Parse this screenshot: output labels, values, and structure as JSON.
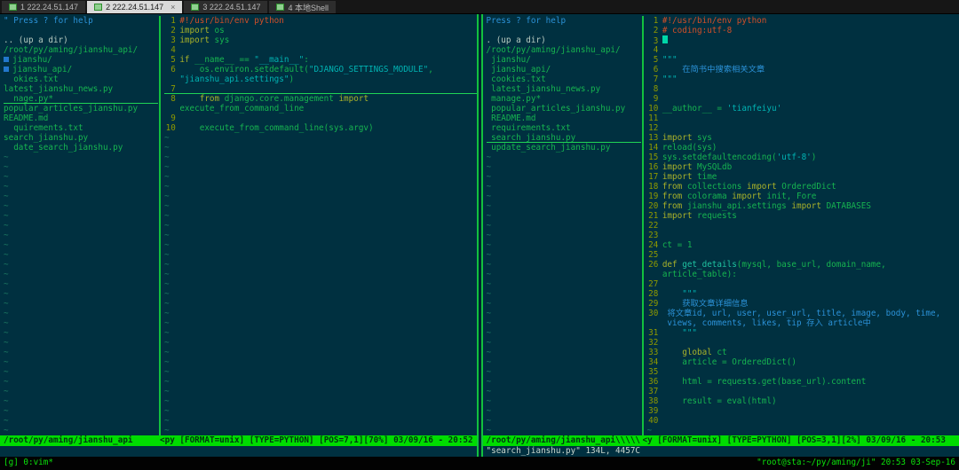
{
  "tabs": [
    {
      "label": "1 222.24.51.147",
      "active": false
    },
    {
      "label": "2 222.24.51.147",
      "active": true
    },
    {
      "label": "3 222.24.51.147",
      "active": false
    },
    {
      "label": "4 本地Shell",
      "active": false
    }
  ],
  "ui": {
    "tilde": "~"
  },
  "tmux": {
    "left": "[g] 0:vim*",
    "right": "\"root@sta:~/py/aming/ji\" 20:53 03-Sep-16"
  },
  "left_vim": {
    "status_tree": "/root/py/aming/jianshu_api",
    "status_code": "<py [FORMAT=unix] [TYPE=PYTHON] [POS=7,1][70%] 03/09/16 - 20:52",
    "cmdline": "",
    "tree_rows": [
      {
        "c": "blue",
        "t": "\" Press ? for help"
      },
      {
        "t": ""
      },
      {
        "c": "fg",
        "t": ".. (up a dir)"
      },
      {
        "c": "green",
        "t": "/root/py/aming/jianshu_api/"
      },
      {
        "c": "green",
        "t": "jianshu/",
        "box": true
      },
      {
        "c": "green",
        "t": "jianshu_api/",
        "box": true
      },
      {
        "c": "green",
        "t": "  okies.txt"
      },
      {
        "c": "green",
        "t": "latest_jianshu_news.py"
      },
      {
        "c": "green",
        "t": "  nage.py*",
        "u": true
      },
      {
        "c": "green",
        "t": "popular_articles_jianshu.py"
      },
      {
        "c": "green",
        "t": "README.md"
      },
      {
        "c": "green",
        "t": "  quirements.txt"
      },
      {
        "c": "green",
        "t": "search_jianshu.py"
      },
      {
        "c": "green",
        "t": "  date_search_jianshu.py"
      }
    ],
    "code_rows": [
      {
        "n": "1",
        "seg": [
          [
            "com",
            "#!/usr/bin/env python"
          ]
        ]
      },
      {
        "n": "2",
        "seg": [
          [
            "kw",
            "import "
          ],
          [
            "id",
            "os"
          ]
        ]
      },
      {
        "n": "3",
        "seg": [
          [
            "kw",
            "import "
          ],
          [
            "id",
            "sys"
          ]
        ]
      },
      {
        "n": "4",
        "seg": []
      },
      {
        "n": "5",
        "seg": [
          [
            "kw",
            "if "
          ],
          [
            "id",
            "__name__ == "
          ],
          [
            "str",
            "\"__main__\""
          ],
          [
            "id",
            ":"
          ]
        ]
      },
      {
        "n": "6",
        "seg": [
          [
            "id",
            "    os.environ.setdefault("
          ],
          [
            "str",
            "\"DJANGO_SETTINGS_MODULE\""
          ],
          [
            "id",
            ","
          ]
        ]
      },
      {
        "n": "",
        "seg": [
          [
            "str",
            "\"jianshu_api.settings\""
          ],
          [
            "id",
            ")"
          ]
        ]
      },
      {
        "n": "7",
        "seg": [],
        "u": true
      },
      {
        "n": "8",
        "seg": [
          [
            "kw",
            "    from "
          ],
          [
            "id",
            "django.core.management "
          ],
          [
            "kw",
            "import"
          ]
        ]
      },
      {
        "n": "",
        "seg": [
          [
            "id",
            "execute_from_command_line"
          ]
        ]
      },
      {
        "n": "9",
        "seg": []
      },
      {
        "n": "10",
        "seg": [
          [
            "id",
            "    execute_from_command_line(sys.argv)"
          ]
        ]
      }
    ]
  },
  "right_vim": {
    "status_tree": "/root/py/aming/jianshu_api\\\\\\\\\\",
    "status_code": "<y [FORMAT=unix] [TYPE=PYTHON] [POS=3,1][2%] 03/09/16 - 20:53",
    "cmdline": "\"search_jianshu.py\" 134L, 4457C",
    "tree_rows": [
      {
        "c": "blue",
        "t": "Press ? for help"
      },
      {
        "t": ""
      },
      {
        "c": "fg",
        "t": ". (up a dir)"
      },
      {
        "c": "green",
        "t": "/root/py/aming/jianshu_api/"
      },
      {
        "c": "green",
        "t": " jianshu/"
      },
      {
        "c": "green",
        "t": " jianshu_api/"
      },
      {
        "c": "green",
        "t": " cookies.txt"
      },
      {
        "c": "green",
        "t": " latest_jianshu_news.py"
      },
      {
        "c": "green",
        "t": " manage.py*"
      },
      {
        "c": "green",
        "t": " popular_articles_jianshu.py"
      },
      {
        "c": "green",
        "t": " README.md"
      },
      {
        "c": "green",
        "t": " requirements.txt"
      },
      {
        "c": "green",
        "t": " search_jianshu.py",
        "u": true
      },
      {
        "c": "green",
        "t": " update_search_jianshu.py"
      }
    ],
    "code_rows": [
      {
        "n": "1",
        "seg": [
          [
            "com",
            "#!/usr/bin/env python"
          ]
        ]
      },
      {
        "n": "2",
        "seg": [
          [
            "com",
            "# coding:utf-8"
          ]
        ]
      },
      {
        "n": "3",
        "seg": [],
        "cursor": true
      },
      {
        "n": "4",
        "seg": []
      },
      {
        "n": "5",
        "seg": [
          [
            "str",
            "\"\"\""
          ]
        ]
      },
      {
        "n": "6",
        "seg": [
          [
            "doc",
            "    在简书中搜索相关文章"
          ]
        ]
      },
      {
        "n": "7",
        "seg": [
          [
            "str",
            "\"\"\""
          ]
        ]
      },
      {
        "n": "8",
        "seg": []
      },
      {
        "n": "9",
        "seg": []
      },
      {
        "n": "10",
        "seg": [
          [
            "id",
            "__author__ = "
          ],
          [
            "str",
            "'tianfeiyu'"
          ]
        ]
      },
      {
        "n": "11",
        "seg": []
      },
      {
        "n": "12",
        "seg": []
      },
      {
        "n": "13",
        "seg": [
          [
            "kw",
            "import "
          ],
          [
            "id",
            "sys"
          ]
        ]
      },
      {
        "n": "14",
        "seg": [
          [
            "id",
            "reload(sys)"
          ]
        ]
      },
      {
        "n": "15",
        "seg": [
          [
            "id",
            "sys.setdefaultencoding("
          ],
          [
            "str",
            "'utf-8'"
          ],
          [
            "id",
            ")"
          ]
        ]
      },
      {
        "n": "16",
        "seg": [
          [
            "kw",
            "import "
          ],
          [
            "id",
            "MySQLdb"
          ]
        ]
      },
      {
        "n": "17",
        "seg": [
          [
            "kw",
            "import "
          ],
          [
            "id",
            "time"
          ]
        ]
      },
      {
        "n": "18",
        "seg": [
          [
            "kw",
            "from "
          ],
          [
            "id",
            "collections "
          ],
          [
            "kw",
            "import "
          ],
          [
            "id",
            "OrderedDict"
          ]
        ]
      },
      {
        "n": "19",
        "seg": [
          [
            "kw",
            "from "
          ],
          [
            "id",
            "colorama "
          ],
          [
            "kw",
            "import "
          ],
          [
            "id",
            "init, Fore"
          ]
        ]
      },
      {
        "n": "20",
        "seg": [
          [
            "kw",
            "from "
          ],
          [
            "id",
            "jianshu_api.settings "
          ],
          [
            "kw",
            "import "
          ],
          [
            "id",
            "DATABASES"
          ]
        ]
      },
      {
        "n": "21",
        "seg": [
          [
            "kw",
            "import "
          ],
          [
            "id",
            "requests"
          ]
        ]
      },
      {
        "n": "22",
        "seg": []
      },
      {
        "n": "23",
        "seg": []
      },
      {
        "n": "24",
        "seg": [
          [
            "id",
            "ct = "
          ],
          [
            "num",
            "1"
          ]
        ]
      },
      {
        "n": "25",
        "seg": []
      },
      {
        "n": "26",
        "seg": [
          [
            "kw",
            "def "
          ],
          [
            "fn",
            "get_details"
          ],
          [
            "id",
            "(mysql, base_url, domain_name,"
          ]
        ]
      },
      {
        "n": "",
        "seg": [
          [
            "id",
            "article_table):"
          ]
        ]
      },
      {
        "n": "27",
        "seg": []
      },
      {
        "n": "28",
        "seg": [
          [
            "str",
            "    \"\"\""
          ]
        ]
      },
      {
        "n": "29",
        "seg": [
          [
            "doc",
            "    获取文章详细信息"
          ]
        ]
      },
      {
        "n": "30",
        "seg": [
          [
            "doc",
            " 将文章id, url, user, user_url, title, image, body, time,"
          ]
        ]
      },
      {
        "n": "",
        "seg": [
          [
            "doc",
            " views, comments, likes, tip 存入 article中"
          ]
        ]
      },
      {
        "n": "31",
        "seg": [
          [
            "str",
            "    \"\"\""
          ]
        ]
      },
      {
        "n": "32",
        "seg": []
      },
      {
        "n": "33",
        "seg": [
          [
            "kw",
            "    global "
          ],
          [
            "id",
            "ct"
          ]
        ]
      },
      {
        "n": "34",
        "seg": [
          [
            "id",
            "    article = OrderedDict()"
          ]
        ]
      },
      {
        "n": "35",
        "seg": []
      },
      {
        "n": "36",
        "seg": [
          [
            "id",
            "    html = requests.get(base_url).content"
          ]
        ]
      },
      {
        "n": "37",
        "seg": []
      },
      {
        "n": "38",
        "seg": [
          [
            "id",
            "    result = eval(html)"
          ]
        ]
      },
      {
        "n": "39",
        "seg": []
      },
      {
        "n": "40",
        "seg": []
      }
    ]
  }
}
